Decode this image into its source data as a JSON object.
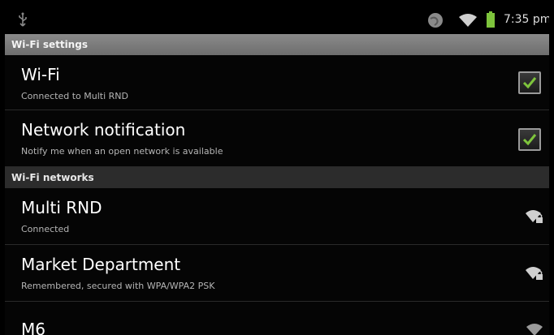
{
  "status_bar": {
    "time": "7:35 pm",
    "icons": [
      "usb-icon",
      "globe-icon",
      "wifi-icon",
      "battery-icon"
    ]
  },
  "sections": {
    "settings_header": "Wi-Fi settings",
    "networks_header": "Wi-Fi networks"
  },
  "settings": {
    "wifi": {
      "title": "Wi-Fi",
      "summary": "Connected to Multi RND",
      "checked": true
    },
    "notification": {
      "title": "Network notification",
      "summary": "Notify me when an open network is available",
      "checked": true
    }
  },
  "networks": [
    {
      "title": "Multi RND",
      "summary": "Connected",
      "icon": "wifi-secured-icon"
    },
    {
      "title": "Market Department",
      "summary": "Remembered, secured with WPA/WPA2 PSK",
      "icon": "wifi-secured-icon"
    },
    {
      "title": "M6",
      "summary": "",
      "icon": "wifi-icon"
    }
  ],
  "colors": {
    "background": "#050505",
    "check_green": "#7ec43c",
    "header_settings": "#7c7c7c",
    "header_networks": "#2c2c2c"
  }
}
